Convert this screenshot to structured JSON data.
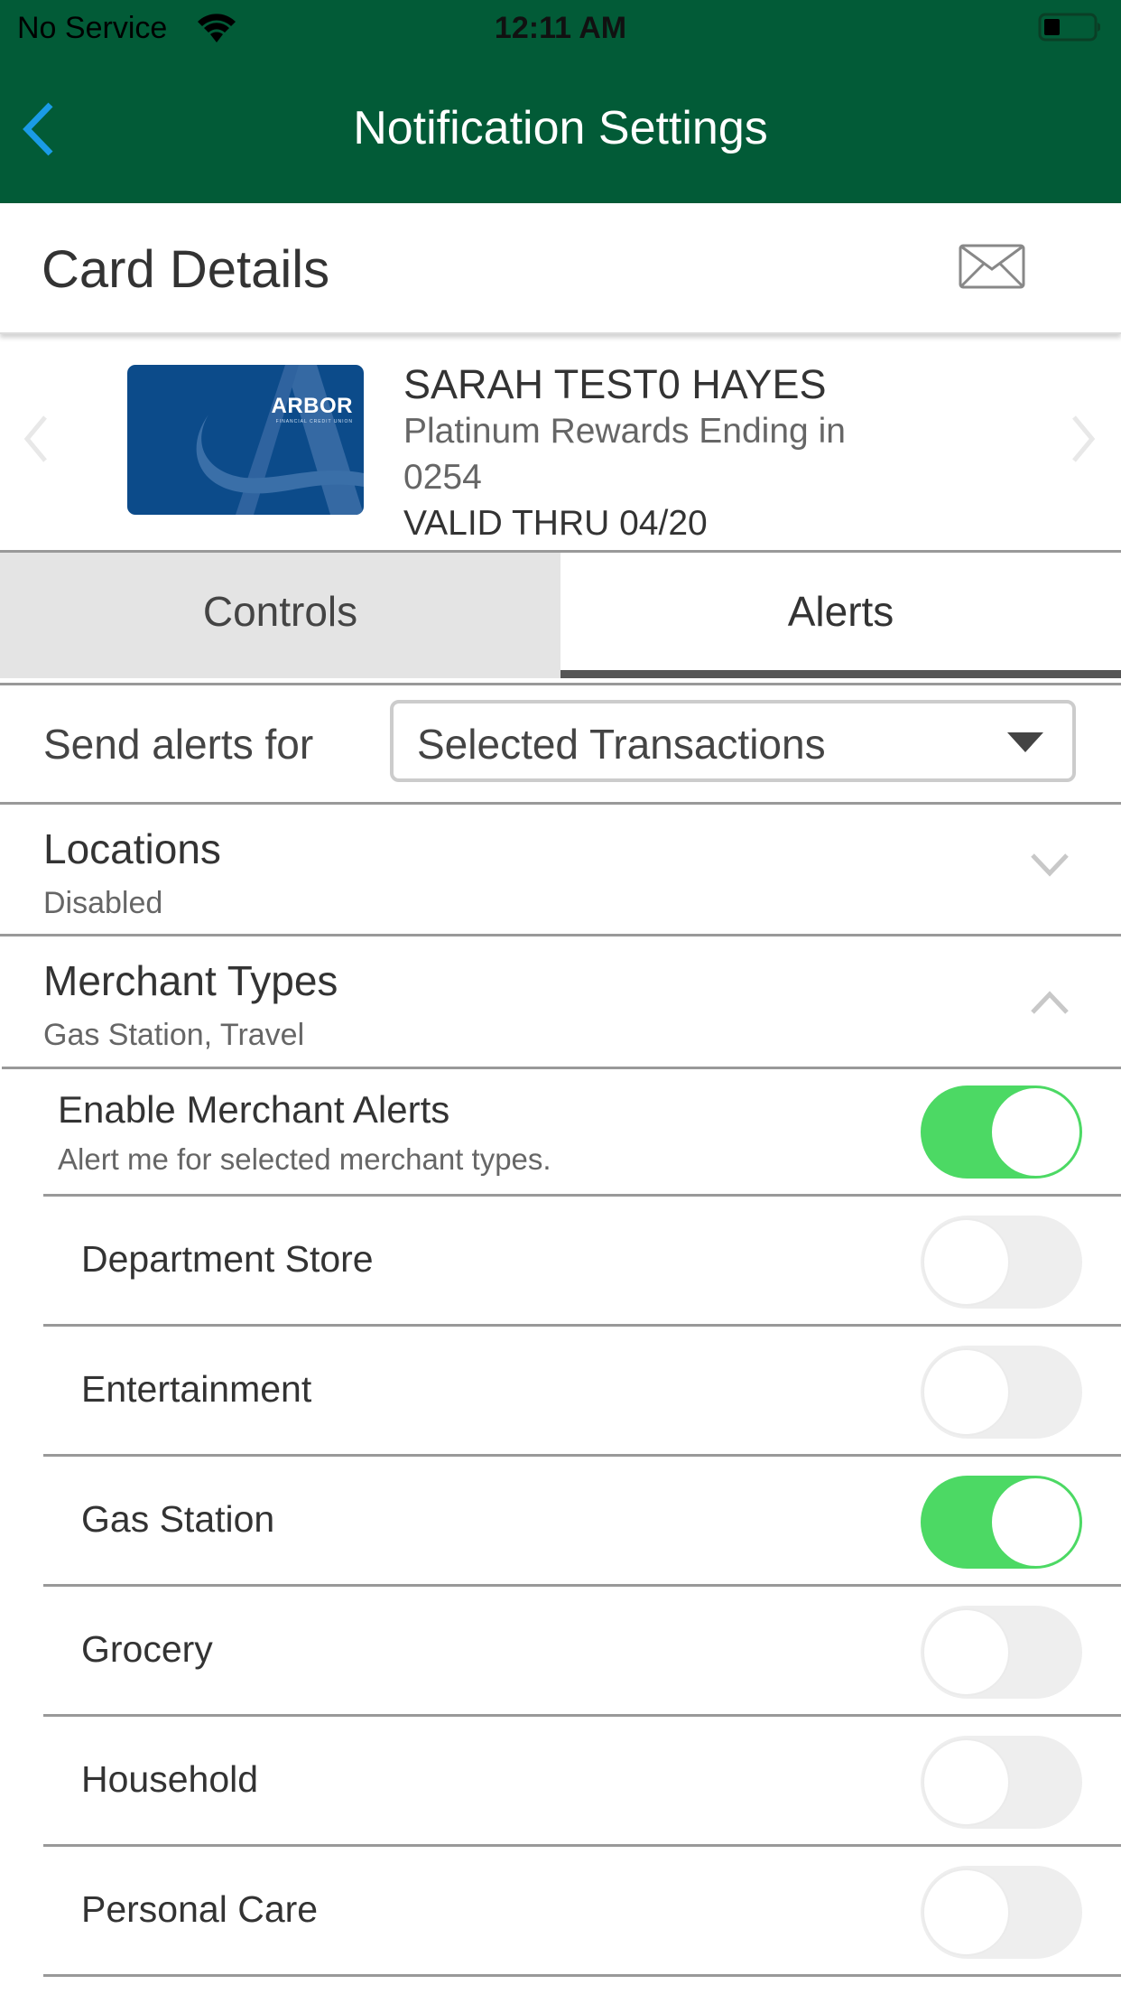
{
  "status_bar": {
    "carrier": "No Service",
    "time": "12:11 AM",
    "wifi_icon": "wifi-icon",
    "battery_icon": "battery-low-icon"
  },
  "nav": {
    "title": "Notification Settings",
    "back_icon": "chevron-left-icon"
  },
  "card_details": {
    "heading": "Card Details",
    "mail_icon": "envelope-icon"
  },
  "card": {
    "brand": "ARBOR",
    "brand_sub": "FINANCIAL CREDIT UNION",
    "holder_name": "SARAH TEST0 HAYES",
    "description_line1": "Platinum Rewards Ending in",
    "description_line2": "0254",
    "valid_thru": "VALID THRU 04/20"
  },
  "tabs": [
    {
      "label": "Controls",
      "active": false
    },
    {
      "label": "Alerts",
      "active": true
    }
  ],
  "send_alerts": {
    "label": "Send alerts for",
    "selected": "Selected Transactions"
  },
  "sections": {
    "locations": {
      "title": "Locations",
      "subtitle": "Disabled",
      "expanded": false
    },
    "merchant_types": {
      "title": "Merchant Types",
      "subtitle": "Gas Station, Travel",
      "expanded": true
    }
  },
  "enable_merchant_alerts": {
    "title": "Enable Merchant Alerts",
    "subtitle": "Alert me for selected merchant types.",
    "on": true
  },
  "merchant_list": [
    {
      "label": "Department Store",
      "on": false
    },
    {
      "label": "Entertainment",
      "on": false
    },
    {
      "label": "Gas Station",
      "on": true
    },
    {
      "label": "Grocery",
      "on": false
    },
    {
      "label": "Household",
      "on": false
    },
    {
      "label": "Personal Care",
      "on": false
    }
  ],
  "colors": {
    "header_green": "#025b37",
    "back_blue": "#1a9be6",
    "toggle_on": "#4cd964",
    "toggle_off": "#eeeeee",
    "card_blue": "#0c4b8a"
  }
}
